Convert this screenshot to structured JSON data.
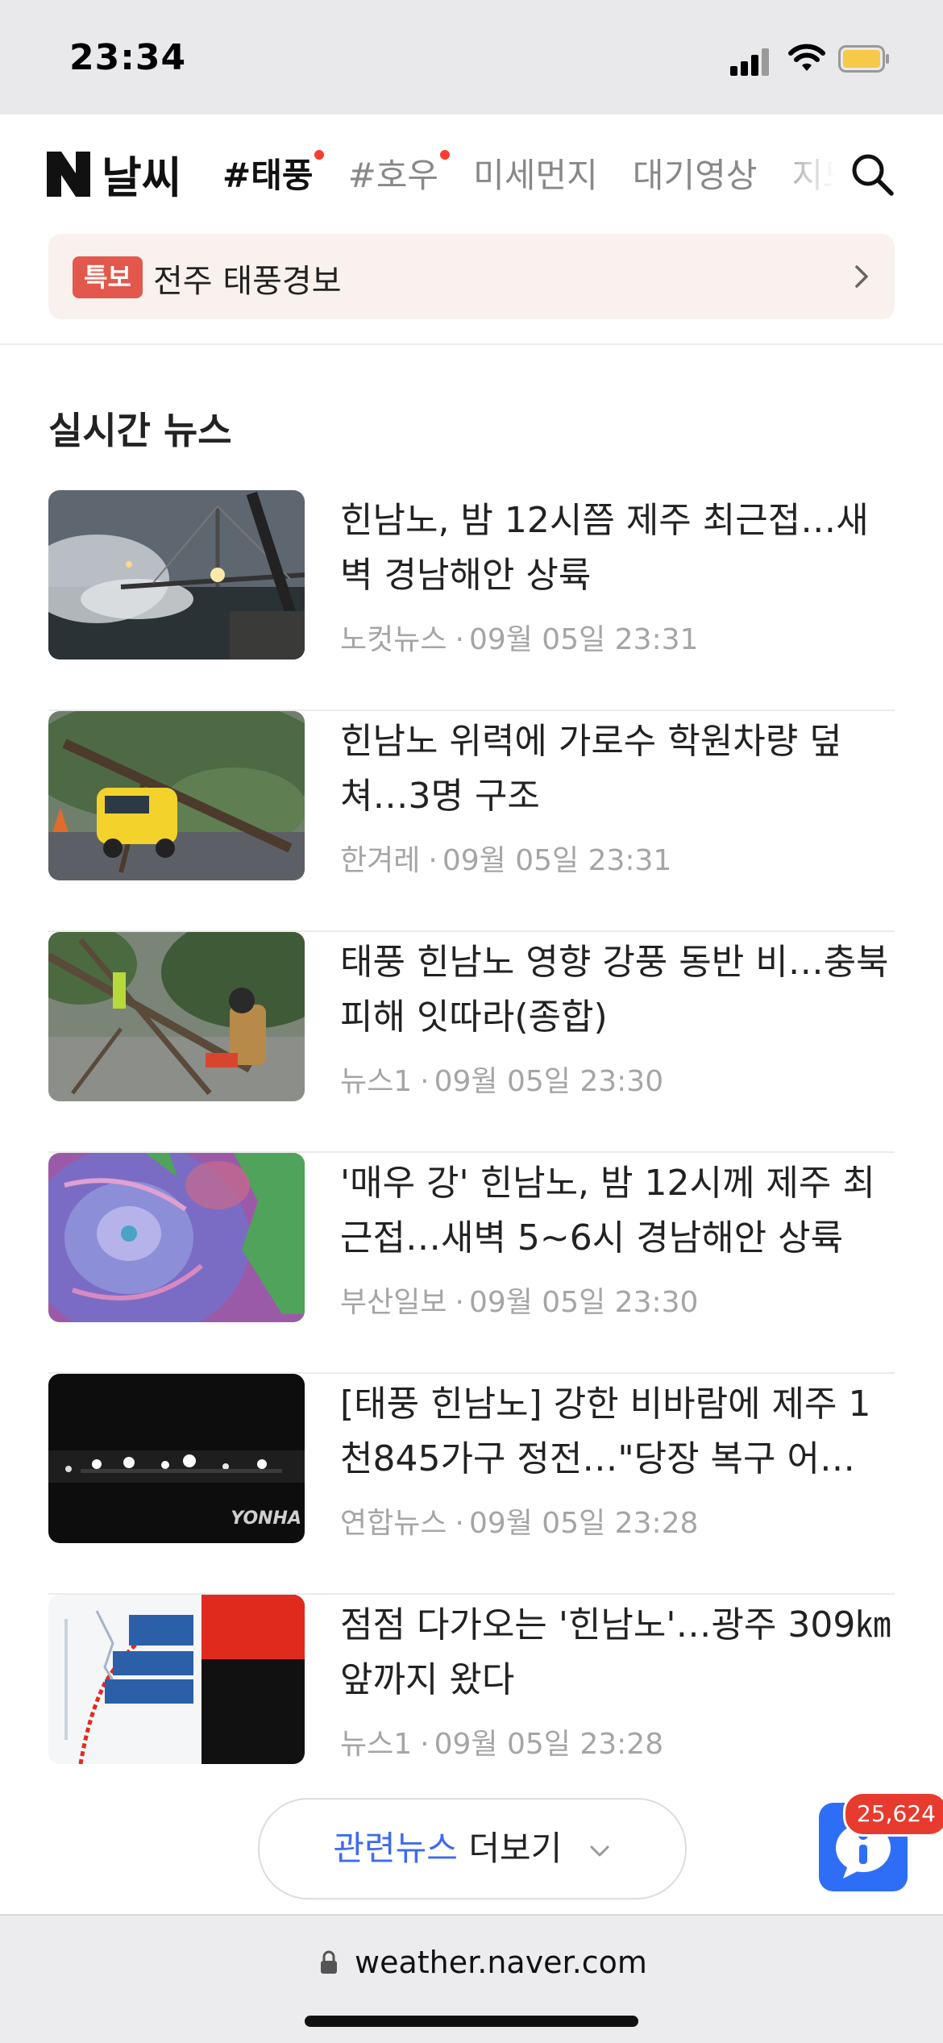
{
  "status_bar": {
    "time": "23:34"
  },
  "header": {
    "logo_text": "날씨",
    "nav": [
      {
        "label": "#태풍",
        "active": true,
        "dot": true
      },
      {
        "label": "#호우",
        "active": false,
        "dot": true
      },
      {
        "label": "미세먼지",
        "active": false,
        "dot": false
      },
      {
        "label": "대기영상",
        "active": false,
        "dot": false
      },
      {
        "label": "지도",
        "active": false,
        "dot": false
      }
    ],
    "alert": {
      "badge": "특보",
      "text": "전주 태풍경보"
    }
  },
  "news": {
    "section_title": "실시간 뉴스",
    "items": [
      {
        "title": "힌남노, 밤 12시쯤 제주 최근접…새벽 경남해안 상륙",
        "source": "노컷뉴스",
        "time": "09월 05일 23:31",
        "thumb": "storm-waves-bridge"
      },
      {
        "title": "힌남노 위력에 가로수 학원차량 덮쳐…3명 구조",
        "source": "한겨레",
        "time": "09월 05일 23:31",
        "thumb": "fallen-tree-yellow-van"
      },
      {
        "title": "태풍 힌남노 영향 강풍 동반 비…충북 피해 잇따라(종합)",
        "source": "뉴스1",
        "time": "09월 05일 23:30",
        "thumb": "firefighter-cutting-tree"
      },
      {
        "title": "'매우 강' 힌남노, 밤 12시께 제주 최근접…새벽 5~6시 경남해안 상륙",
        "source": "부산일보",
        "time": "09월 05일 23:30",
        "thumb": "typhoon-satellite-map"
      },
      {
        "title": "[태풍 힌남노] 강한 비바람에 제주 1천845가구 정전…\"당장 복구 어…",
        "source": "연합뉴스",
        "time": "09월 05일 23:28",
        "thumb": "dark-night-lights",
        "thumb_watermark": "YONHA"
      },
      {
        "title": "점점 다가오는 '힌남노'…광주 309㎞ 앞까지 왔다",
        "source": "뉴스1",
        "time": "09월 05일 23:28",
        "thumb": "typhoon-track-map"
      }
    ],
    "more_accent": "관련뉴스",
    "more_rest": "더보기"
  },
  "fab": {
    "badge": "25,624",
    "icon": "info-chat-icon"
  },
  "browser": {
    "url": "weather.naver.com"
  },
  "colors": {
    "accent": "#3e6bef",
    "alert_badge": "#e2584c",
    "fab": "#2e6ef7",
    "nav_dot": "#ff3b30"
  }
}
